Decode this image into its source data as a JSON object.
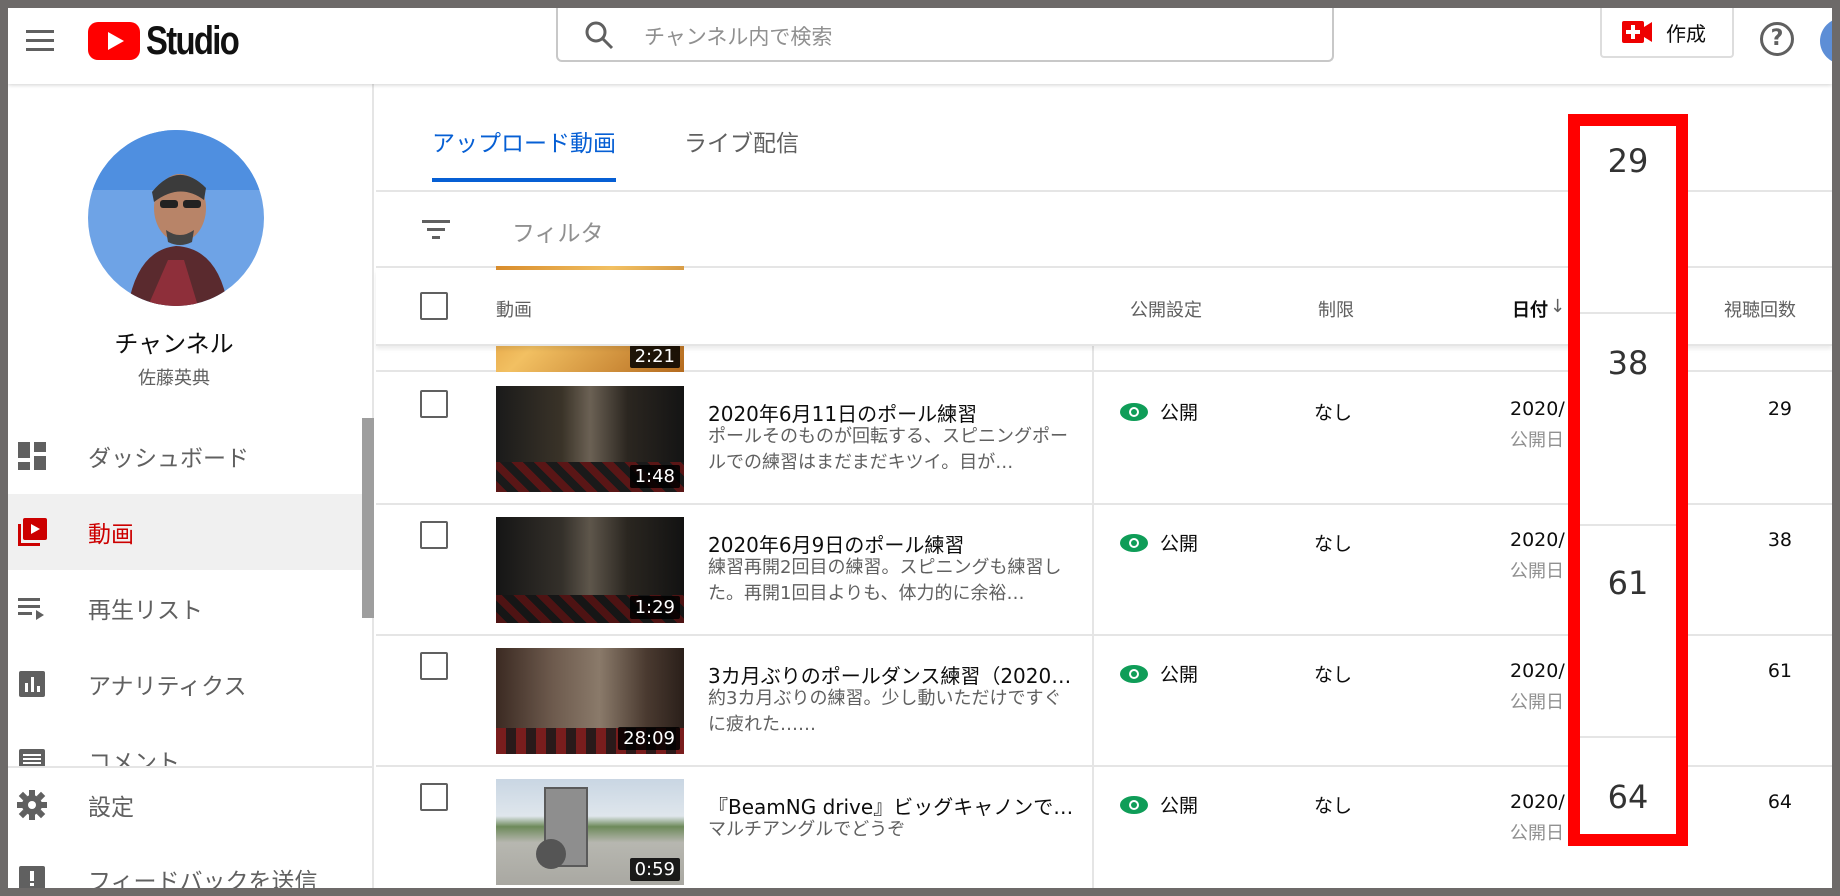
{
  "header": {
    "logo_text": "Studio",
    "search_placeholder": "チャンネル内で検索",
    "create_label": "作成",
    "help_symbol": "?"
  },
  "sidebar": {
    "channel_title": "チャンネル",
    "channel_owner": "佐藤英典",
    "items": [
      {
        "label": "ダッシュボード",
        "icon": "dashboard-icon"
      },
      {
        "label": "動画",
        "icon": "video-icon",
        "active": true
      },
      {
        "label": "再生リスト",
        "icon": "playlist-icon"
      },
      {
        "label": "アナリティクス",
        "icon": "analytics-icon"
      },
      {
        "label": "コメント",
        "icon": "comment-icon"
      }
    ],
    "bottom_items": [
      {
        "label": "設定",
        "icon": "gear-icon"
      },
      {
        "label": "フィードバックを送信",
        "icon": "feedback-icon"
      }
    ]
  },
  "main": {
    "tabs": [
      {
        "label": "アップロード動画",
        "active": true
      },
      {
        "label": "ライブ配信",
        "active": false
      }
    ],
    "filter_placeholder": "フィルタ",
    "columns": {
      "video": "動画",
      "visibility": "公開設定",
      "restriction": "制限",
      "date": "日付",
      "views": "視聴回数"
    },
    "partial_row": {
      "duration": "2:21"
    },
    "rows": [
      {
        "title": "2020年6月11日のポール練習",
        "description": "ポールそのものが回転する、スピニングポールでの練習はまだまだキツイ。目が…",
        "duration": "1:48",
        "visibility": "公開",
        "restriction": "なし",
        "date": "2020/",
        "date_sub": "公開日",
        "views": "29"
      },
      {
        "title": "2020年6月9日のポール練習",
        "description": "練習再開2回目の練習。スピニングも練習した。再開1回目よりも、体力的に余裕…",
        "duration": "1:29",
        "visibility": "公開",
        "restriction": "なし",
        "date": "2020/",
        "date_sub": "公開日",
        "views": "38"
      },
      {
        "title": "3カ月ぶりのポールダンス練習（2020…",
        "description": "約3カ月ぶりの練習。少し動いただけですぐに疲れた……",
        "duration": "28:09",
        "visibility": "公開",
        "restriction": "なし",
        "date": "2020/",
        "date_sub": "公開日",
        "views": "61"
      },
      {
        "title": "『BeamNG drive』ビッグキャノンで…",
        "description": "マルチアングルでどうぞ",
        "duration": "0:59",
        "visibility": "公開",
        "restriction": "なし",
        "date": "2020/",
        "date_sub": "公開日",
        "views": "64"
      }
    ]
  },
  "highlight": {
    "color": "#ff0000",
    "values": [
      "29",
      "38",
      "61",
      "64"
    ]
  },
  "colors": {
    "accent": "#065fd4",
    "brand_red": "#ff0000",
    "active_nav": "#cc0000",
    "public_eye": "#0f9d58"
  }
}
